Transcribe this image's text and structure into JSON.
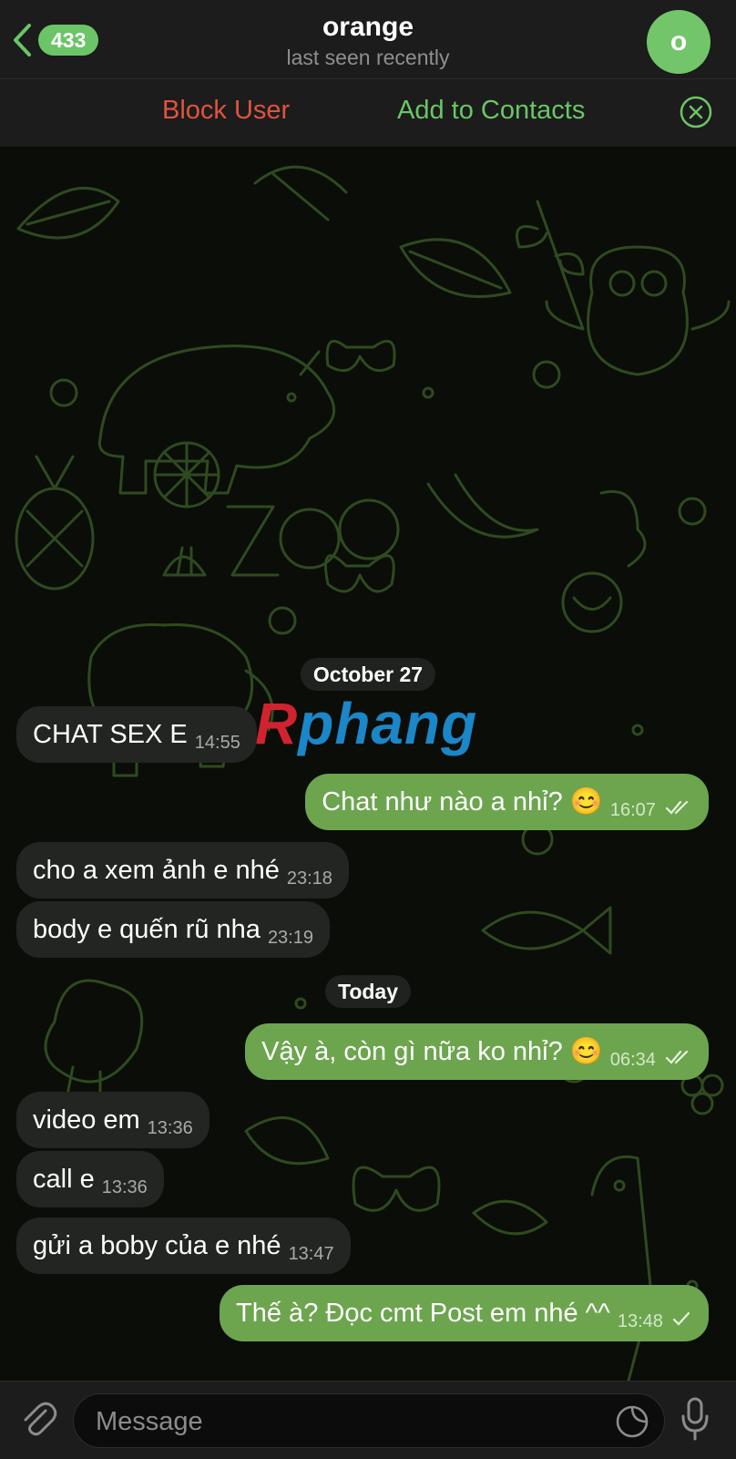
{
  "header": {
    "back_count": "433",
    "title": "orange",
    "subtitle": "last seen recently",
    "avatar_letter": "o",
    "avatar_color": "#73c56a"
  },
  "actions": {
    "block_label": "Block User",
    "add_label": "Add to Contacts",
    "block_color": "#e0533f",
    "add_color": "#6bc567"
  },
  "watermark": {
    "first": "R",
    "rest": "phang"
  },
  "chat": {
    "date1": "October 27",
    "date2": "Today",
    "messages": [
      {
        "dir": "in",
        "text": "CHAT SEX E",
        "time": "14:55"
      },
      {
        "dir": "out",
        "text": "Chat như nào a nhỉ? 😊",
        "time": "16:07",
        "status": "read"
      },
      {
        "dir": "in",
        "text": "cho a xem ảnh e nhé",
        "time": "23:18"
      },
      {
        "dir": "in",
        "text": "body e quến rũ nha",
        "time": "23:19"
      },
      {
        "dir": "out",
        "text": "Vậy à, còn gì nữa ko nhỉ? 😊",
        "time": "06:34",
        "status": "read"
      },
      {
        "dir": "in",
        "text": "video em",
        "time": "13:36"
      },
      {
        "dir": "in",
        "text": "call e",
        "time": "13:36"
      },
      {
        "dir": "in",
        "text": "gửi a boby của e nhé",
        "time": "13:47"
      },
      {
        "dir": "out",
        "text": "Thế à? Đọc cmt Post em nhé ^^",
        "time": "13:48",
        "status": "sent"
      }
    ]
  },
  "input": {
    "placeholder": "Message"
  },
  "icons": {
    "back": "chevron-left-icon",
    "close": "close-circle-icon",
    "attach": "paperclip-icon",
    "sticker": "sticker-icon",
    "mic": "microphone-icon"
  }
}
